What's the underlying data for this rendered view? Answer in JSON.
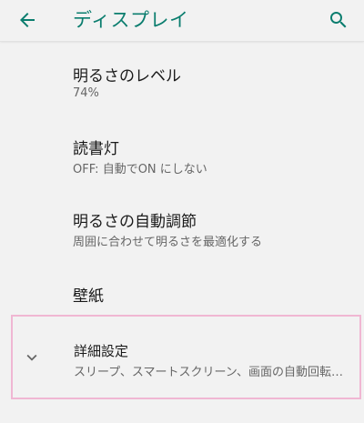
{
  "toolbar": {
    "title": "ディスプレイ",
    "back_icon": "arrow-back-icon",
    "search_icon": "search-icon",
    "accent_color": "#0a7d6e"
  },
  "settings": [
    {
      "title": "明るさのレベル",
      "summary": "74%"
    },
    {
      "title": "読書灯",
      "summary": "OFF: 自動でON にしない"
    },
    {
      "title": "明るさの自動調節",
      "summary": "周囲に合わせて明るさを最適化する"
    },
    {
      "title": "壁紙"
    }
  ],
  "advanced": {
    "icon": "chevron-down-icon",
    "title": "詳細設定",
    "summary": "スリープ、スマートスクリーン、画面の自動回転、色、フォントサイズ",
    "highlight_color": "#f0b7d3"
  }
}
